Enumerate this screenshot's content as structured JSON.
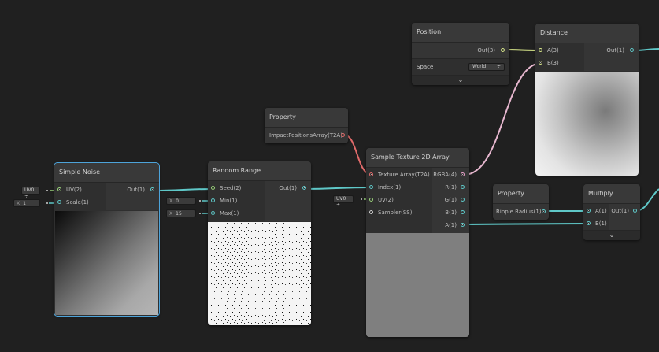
{
  "colors": {
    "background": "#202020",
    "wire_float": "#5fc8c8",
    "wire_vec": "#d8e68a",
    "wire_texarray": "#e06a6a",
    "wire_color": "#e6a0c8",
    "wire_uv": "#9ad27a",
    "selection": "#4da3d9"
  },
  "nodes": {
    "simple_noise": {
      "title": "Simple Noise",
      "inputs": [
        "UV(2)",
        "Scale(1)"
      ],
      "outputs": [
        "Out(1)"
      ],
      "uv_default": "UV0 ÷",
      "scale_default": {
        "axis": "X",
        "value": "1"
      }
    },
    "random_range": {
      "title": "Random Range",
      "inputs": [
        "Seed(2)",
        "Min(1)",
        "Max(1)"
      ],
      "outputs": [
        "Out(1)"
      ],
      "min_default": {
        "axis": "X",
        "value": "0"
      },
      "max_default": {
        "axis": "X",
        "value": "15"
      }
    },
    "property_impact": {
      "title": "Property",
      "outputs": [
        "ImpactPositionsArray(T2A)"
      ]
    },
    "sample_texture": {
      "title": "Sample Texture 2D Array",
      "inputs": [
        "Texture Array(T2A)",
        "Index(1)",
        "UV(2)",
        "Sampler(SS)"
      ],
      "outputs": [
        "RGBA(4)",
        "R(1)",
        "G(1)",
        "B(1)",
        "A(1)"
      ],
      "uv_default": "UV0 ÷"
    },
    "position": {
      "title": "Position",
      "outputs": [
        "Out(3)"
      ],
      "space_label": "Space",
      "space_value": "World"
    },
    "distance": {
      "title": "Distance",
      "inputs": [
        "A(3)",
        "B(3)"
      ],
      "outputs": [
        "Out(1)"
      ]
    },
    "property_ripple": {
      "title": "Property",
      "outputs": [
        "Ripple Radius(1)"
      ]
    },
    "multiply": {
      "title": "Multiply",
      "inputs": [
        "A(1)",
        "B(1)"
      ],
      "outputs": [
        "Out(1)"
      ]
    }
  },
  "chevron": "⌄"
}
